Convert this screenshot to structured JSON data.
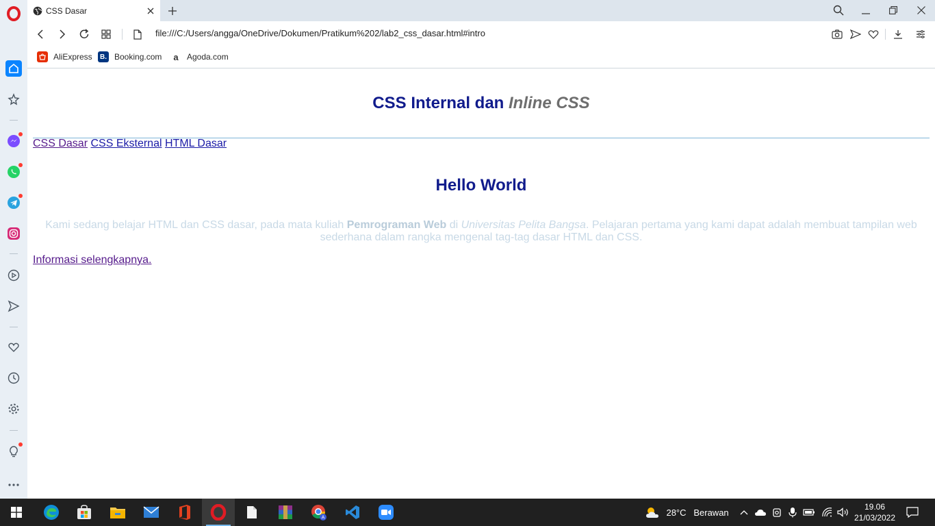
{
  "browser": {
    "tab_title": "CSS Dasar",
    "url": "file:///C:/Users/angga/OneDrive/Dokumen/Pratikum%202/lab2_css_dasar.html#intro",
    "bookmarks": [
      {
        "label": "AliExpress",
        "color": "#e62e04"
      },
      {
        "label": "Booking.com",
        "color": "#003580",
        "glyph": "B."
      },
      {
        "label": "Agoda.com",
        "glyph": "a"
      }
    ]
  },
  "page": {
    "header_title_part1": "CSS Internal dan ",
    "header_title_part2": "Inline CSS",
    "nav": [
      "CSS Dasar",
      "CSS Eksternal",
      "HTML Dasar"
    ],
    "hello": "Hello World",
    "intro": {
      "t1": "Kami sedang belajar HTML dan CSS dasar, pada mata kuliah ",
      "b1": "Pemrograman Web",
      "t2": " di ",
      "i1": "Universitas Pelita Bangsa",
      "t3": ". Pelajaran pertama yang kami dapat adalah membuat tampilan web sederhana dalam rangka mengenal tag-tag dasar HTML dan CSS."
    },
    "more_link": "Informasi selengkapnya."
  },
  "taskbar": {
    "weather": "28°C",
    "weather_desc": "Berawan",
    "time": "19.06",
    "date": "21/03/2022"
  },
  "colors": {
    "accent": "#101b8c",
    "opera_red": "#e01c24",
    "sidebar_bg": "#e9eff5"
  }
}
